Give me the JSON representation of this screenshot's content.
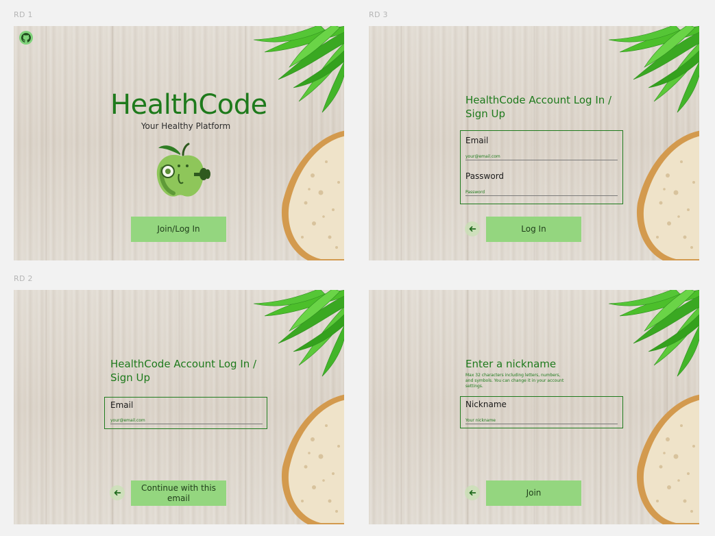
{
  "frames": {
    "rd1": {
      "label": "RD 1",
      "title": "HealthCode",
      "subtitle": "Your Healthy Platform",
      "join_button": "Join/Log In"
    },
    "rd2": {
      "label": "RD 2",
      "heading_line1": "HealthCode Account Log In /",
      "heading_line2": "Sign Up",
      "email_label": "Email",
      "email_placeholder": "your@email.com",
      "continue_line1": "Continue with this",
      "continue_line2": "email"
    },
    "rd3": {
      "label": "RD 3",
      "heading_line1": "HealthCode Account Log In /",
      "heading_line2": "Sign Up",
      "email_label": "Email",
      "email_placeholder": "your@email.com",
      "password_label": "Password",
      "password_placeholder": "Password",
      "login_button": "Log In"
    },
    "rd4": {
      "heading": "Enter a nickname",
      "helper_line1": "Max 32 characters including letters, numbers,",
      "helper_line2": "and symbols. You can change it in your account",
      "helper_line3": "settings.",
      "nickname_label": "Nickname",
      "nickname_placeholder": "Your nickname",
      "join_button": "Join"
    }
  },
  "icons": {
    "github": "github-icon",
    "back": "arrow-left-icon",
    "mascot": "apple-mascot-icon"
  },
  "colors": {
    "brand_green": "#1e7a1c",
    "button_green": "#94d67f",
    "page_bg": "#f2f2f2"
  }
}
